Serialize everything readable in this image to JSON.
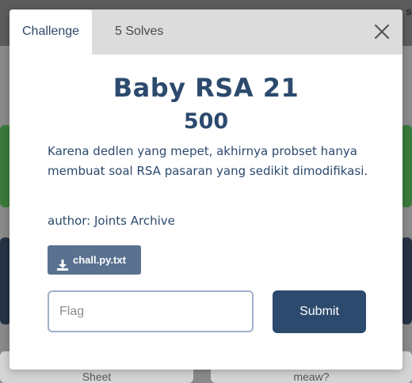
{
  "background": {
    "header_partial_text": "s",
    "bottom_cards": [
      {
        "label": "Sheet"
      },
      {
        "label": "meaw?"
      }
    ]
  },
  "modal": {
    "tabs": [
      {
        "label": "Challenge",
        "active": true
      },
      {
        "label": "5 Solves",
        "active": false
      }
    ],
    "close_icon": "close-x-icon",
    "title": "Baby RSA 21",
    "points": "500",
    "description": "Karena dedlen yang mepet, akhirnya probset hanya membuat soal RSA pasaran yang sedikit dimodifikasi.",
    "author": "author: Joints Archive",
    "file": {
      "label": "chall.py.txt",
      "icon": "download-icon"
    },
    "flag_input": {
      "placeholder": "Flag",
      "value": ""
    },
    "submit_label": "Submit"
  },
  "colors": {
    "primary": "#2c4a6e",
    "file_button": "#5a7190",
    "tab_bar": "#dcdcdc",
    "input_border": "#9fb0c8"
  }
}
